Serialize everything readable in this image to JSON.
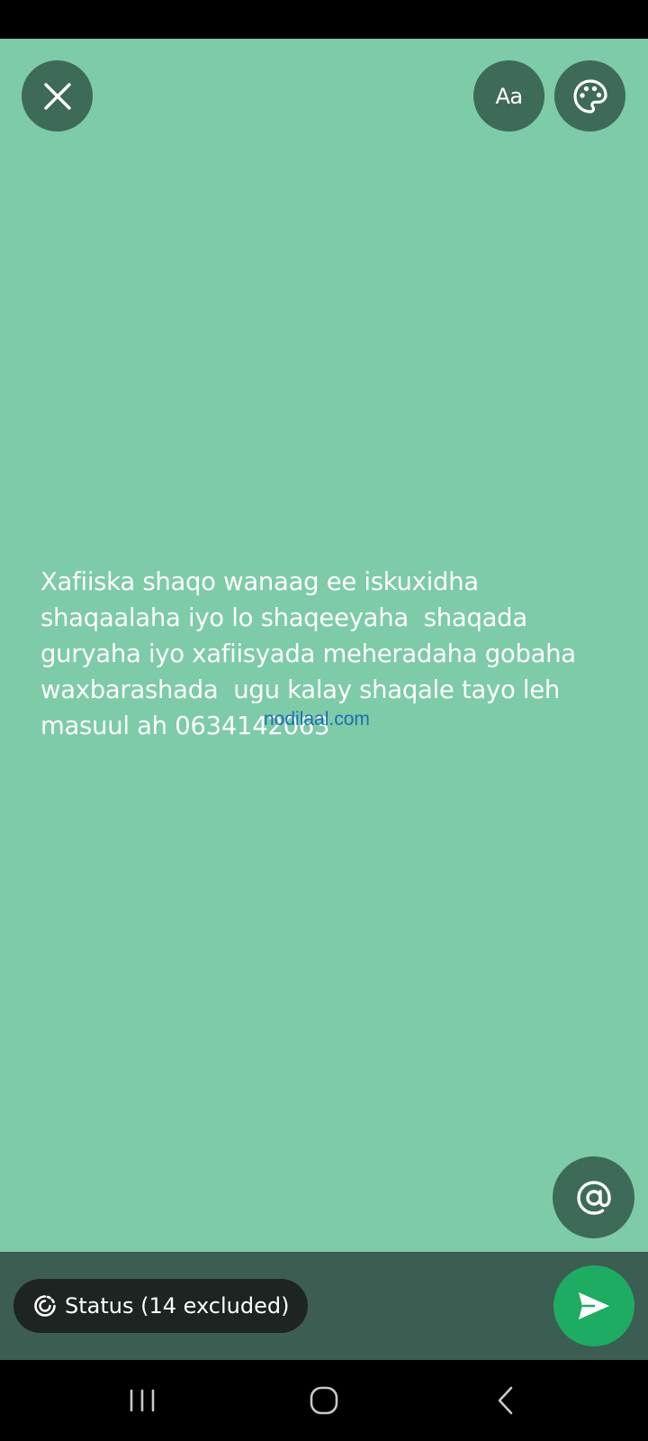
{
  "composer": {
    "background_color": "#7dcba7",
    "text": "Xafiiska shaqo wanaag ee iskuxidha\nshaqaalaha iyo lo shaqeeyaha  shaqada\nguryaha iyo xafiisyada meheradaha gobaha\nwaxbarashada  ugu kalay shaqale tayo leh\nmasuul ah 0634142063",
    "watermark": "nodilaal.com"
  },
  "toolbar": {
    "close_icon": "close-icon",
    "font_label": "Aa",
    "palette_icon": "palette-icon"
  },
  "mention": {
    "icon": "at-sign-icon"
  },
  "footer": {
    "audience_label": "Status (14 excluded)",
    "audience_icon": "status-ring-icon",
    "send_icon": "send-icon",
    "send_color": "#1eab62"
  },
  "nav": {
    "recents_icon": "recents-icon",
    "home_icon": "home-icon",
    "back_icon": "back-icon"
  }
}
